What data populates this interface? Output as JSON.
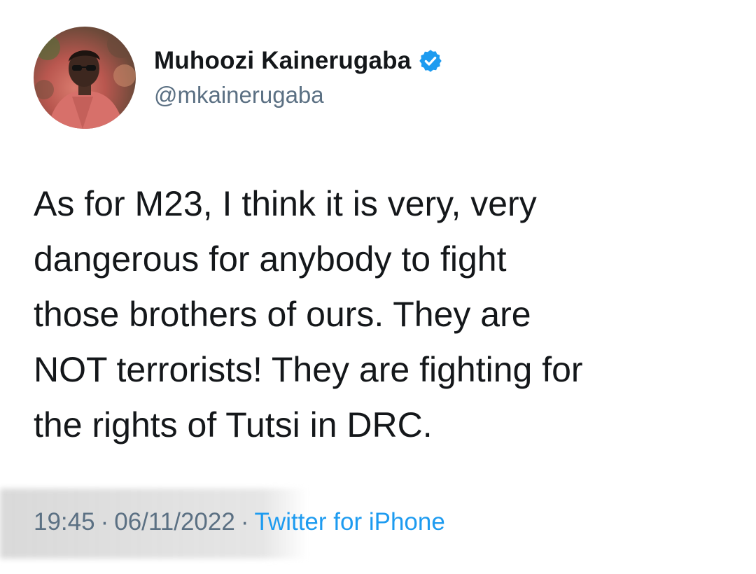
{
  "tweet": {
    "author": {
      "display_name": "Muhoozi Kainerugaba",
      "handle": "@mkainerugaba",
      "verified_icon": "verified-badge-icon",
      "avatar": "avatar-photo"
    },
    "text": "As for M23, I think it is very, very\ndangerous for anybody to fight\nthose brothers of ours. They are\nNOT terrorists! They are fighting for\nthe rights of Tutsi in DRC.",
    "meta": {
      "time": "19:45",
      "separator": "·",
      "date": "06/11/2022",
      "source": "Twitter for iPhone"
    }
  },
  "colors": {
    "primary_text": "#14171a",
    "secondary_text": "#5b7083",
    "link_blue": "#1d9bf0",
    "verified_blue": "#1d9bf0"
  }
}
